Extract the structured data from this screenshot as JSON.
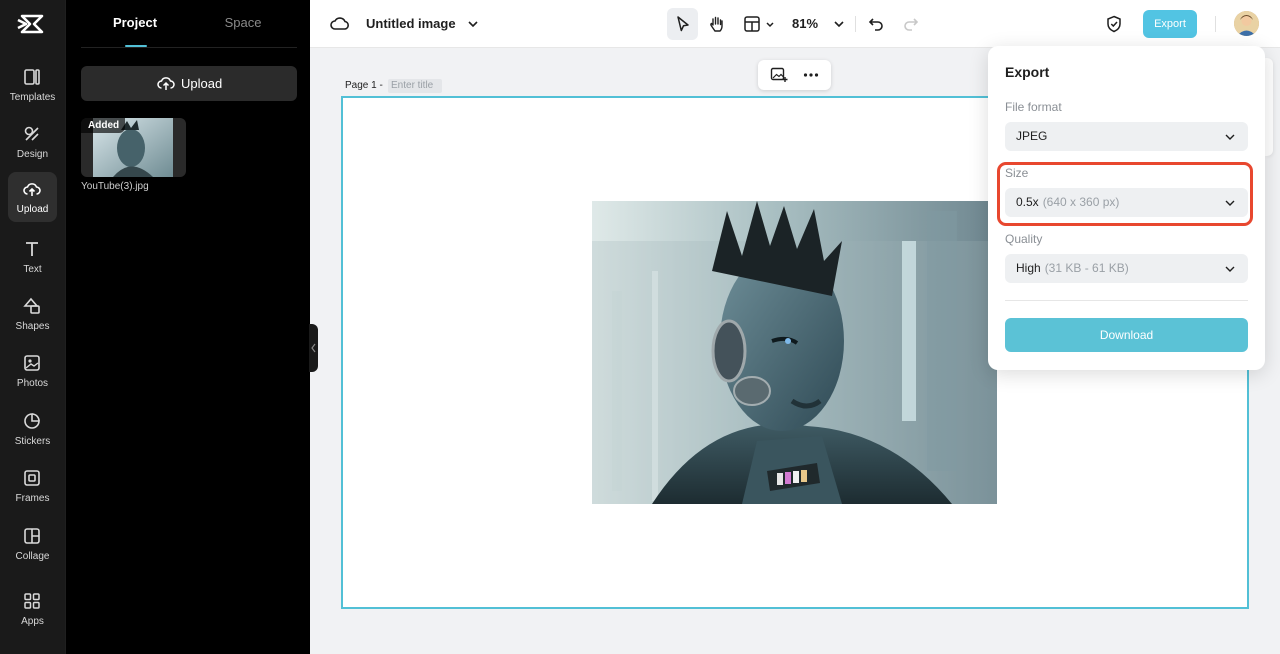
{
  "rail": {
    "items": [
      {
        "label": "Templates",
        "icon": "templates-icon"
      },
      {
        "label": "Design",
        "icon": "design-icon"
      },
      {
        "label": "Upload",
        "icon": "upload-cloud-icon",
        "active": true
      },
      {
        "label": "Text",
        "icon": "text-icon"
      },
      {
        "label": "Shapes",
        "icon": "shapes-icon"
      },
      {
        "label": "Photos",
        "icon": "photos-icon"
      },
      {
        "label": "Stickers",
        "icon": "stickers-icon"
      },
      {
        "label": "Frames",
        "icon": "frames-icon"
      },
      {
        "label": "Collage",
        "icon": "collage-icon"
      },
      {
        "label": "Apps",
        "icon": "apps-icon"
      }
    ]
  },
  "panel": {
    "tabs": [
      {
        "label": "Project",
        "active": true
      },
      {
        "label": "Space",
        "active": false
      }
    ],
    "upload_label": "Upload",
    "asset": {
      "badge": "Added",
      "filename": "YouTube(3).jpg"
    }
  },
  "topbar": {
    "title": "Untitled image",
    "zoom": "81%",
    "export_label": "Export"
  },
  "canvas": {
    "page_label": "Page 1 -",
    "title_placeholder": "Enter title"
  },
  "export_panel": {
    "title": "Export",
    "file_format_label": "File format",
    "file_format_value": "JPEG",
    "size_label": "Size",
    "size_value": "0.5x",
    "size_detail": "(640 x 360 px)",
    "quality_label": "Quality",
    "quality_value": "High",
    "quality_detail": "(31 KB - 61 KB)",
    "download_label": "Download"
  },
  "colors": {
    "accent": "#52c0d6",
    "export_button": "#52c4e3",
    "highlight": "#e8472f",
    "rail_bg": "#1a1a1a",
    "panel_bg": "#000000"
  }
}
